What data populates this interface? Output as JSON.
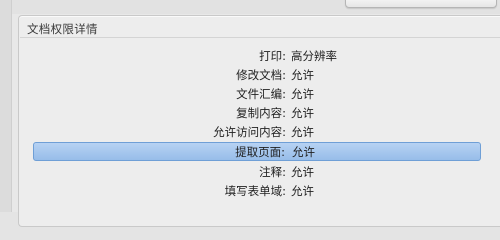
{
  "panel": {
    "title": "文档权限详情"
  },
  "permissions": [
    {
      "label": "打印:",
      "value": "高分辨率",
      "selected": false
    },
    {
      "label": "修改文档:",
      "value": "允许",
      "selected": false
    },
    {
      "label": "文件汇编:",
      "value": "允许",
      "selected": false
    },
    {
      "label": "复制内容:",
      "value": "允许",
      "selected": false
    },
    {
      "label": "允许访问内容:",
      "value": "允许",
      "selected": false
    },
    {
      "label": "提取页面:",
      "value": "允许",
      "selected": true
    },
    {
      "label": "注释:",
      "value": "允许",
      "selected": false
    },
    {
      "label": "填写表单域:",
      "value": "允许",
      "selected": false
    }
  ],
  "colors": {
    "selection": "#a9c8ef",
    "selection_border": "#6f9fd6"
  }
}
